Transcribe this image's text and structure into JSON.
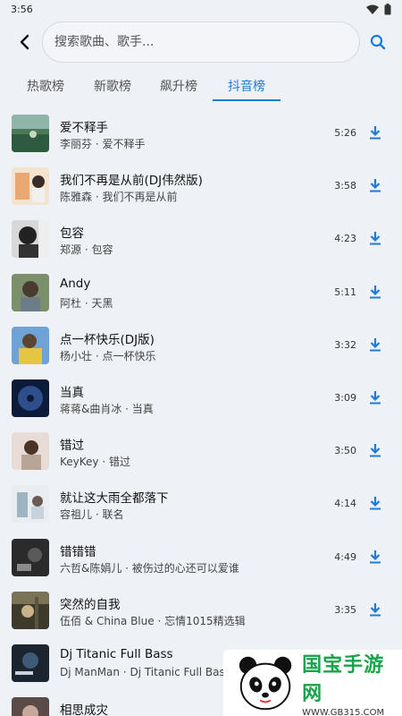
{
  "status": {
    "time": "3:56"
  },
  "search": {
    "placeholder": "搜索歌曲、歌手..."
  },
  "tabs": [
    {
      "label": "热歌榜",
      "active": false
    },
    {
      "label": "新歌榜",
      "active": false
    },
    {
      "label": "飙升榜",
      "active": false
    },
    {
      "label": "抖音榜",
      "active": true
    }
  ],
  "songs": [
    {
      "title": "爱不释手",
      "subtitle": "李丽芬 · 爱不释手",
      "duration": "5:26"
    },
    {
      "title": "我们不再是从前(DJ伟然版)",
      "subtitle": "陈雅森 · 我们不再是从前",
      "duration": "3:58"
    },
    {
      "title": "包容",
      "subtitle": "郑源 · 包容",
      "duration": "4:23"
    },
    {
      "title": "Andy",
      "subtitle": "阿杜 · 天黑",
      "duration": "5:11"
    },
    {
      "title": "点一杯快乐(DJ版)",
      "subtitle": "杨小壮 · 点一杯快乐",
      "duration": "3:32"
    },
    {
      "title": "当真",
      "subtitle": "蒋蒋&曲肖冰 · 当真",
      "duration": "3:09"
    },
    {
      "title": "错过",
      "subtitle": "KeyKey · 错过",
      "duration": "3:50"
    },
    {
      "title": "就让这大雨全都落下",
      "subtitle": "容祖儿 · 联名",
      "duration": "4:14"
    },
    {
      "title": "错错错",
      "subtitle": "六哲&陈娟儿 · 被伤过的心还可以爱谁",
      "duration": "4:49"
    },
    {
      "title": "突然的自我",
      "subtitle": "伍佰 & China Blue · 忘情1015精选辑",
      "duration": "3:35"
    },
    {
      "title": "Dj Titanic Full Bass",
      "subtitle": "Dj ManMan · Dj Titanic Full Bass",
      "duration": ""
    },
    {
      "title": "相思成灾",
      "subtitle": "",
      "duration": ""
    }
  ],
  "watermark": {
    "title": "国宝手游网",
    "url": "WWW.GB315.COM"
  },
  "colors": {
    "accent": "#1f7ad8",
    "background": "#eef1f5"
  }
}
